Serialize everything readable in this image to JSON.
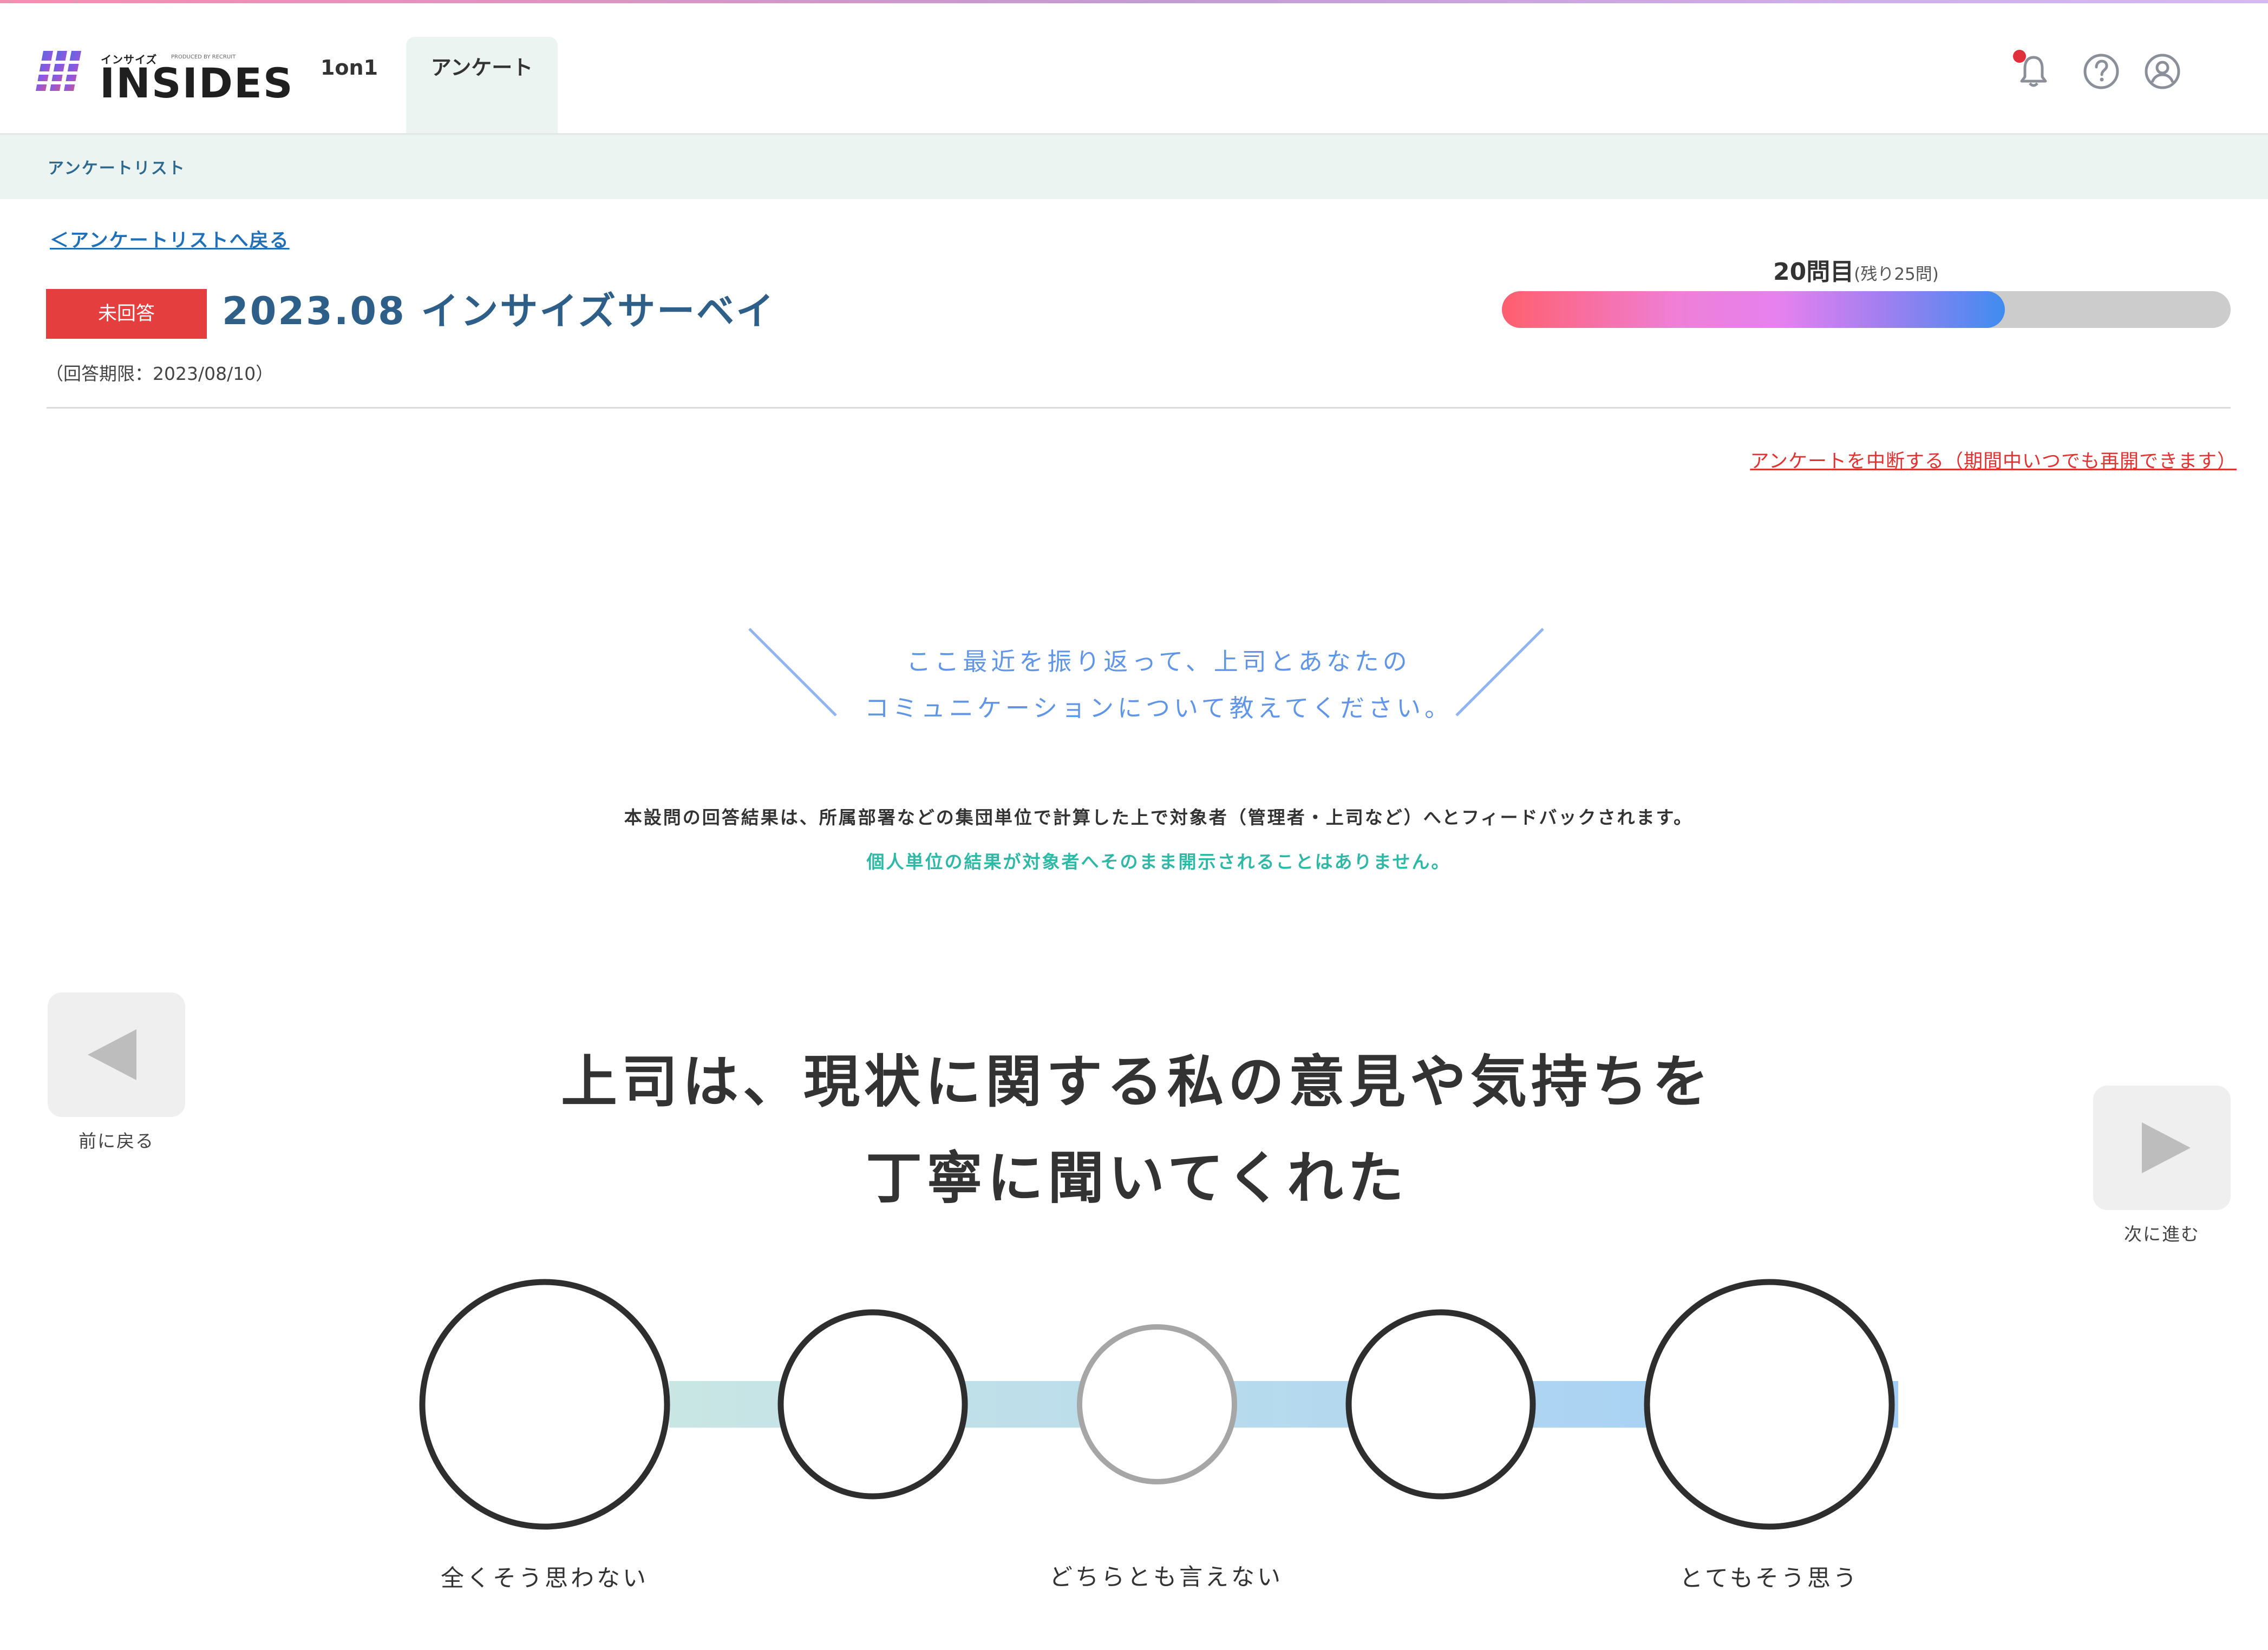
{
  "app": {
    "logo": {
      "small_text": "インサイズ",
      "produced_by": "PRODUCED BY RECRUIT",
      "main_text": "INSIDES"
    },
    "tabs": [
      {
        "label": "1on1"
      },
      {
        "label": "アンケート"
      }
    ],
    "header_icons": [
      "bell-icon",
      "help-icon",
      "account-icon"
    ],
    "colors": {
      "accent_red": "#e53e3e",
      "title_blue": "#2d5f88",
      "prompt_blue": "#6196e6",
      "notice_green": "#2fb8a6",
      "subbar_bg": "#ecf4f1"
    }
  },
  "subnav": {
    "breadcrumb": "アンケートリスト"
  },
  "survey": {
    "back_link": "＜アンケートリストへ戻る",
    "status": "未回答",
    "title": "2023.08 インサイズサーベイ",
    "deadline": "（回答期限：2023/08/10）",
    "progress": {
      "current": "20問目",
      "remaining": "(残り25問)",
      "fraction": 0.69
    },
    "suspend_link": "アンケートを中断する（期間中いつでも再開できます）"
  },
  "section": {
    "prompt_line1": "ここ最近を振り返って、上司とあなたの",
    "prompt_line2": "コミュニケーションについて教えてください。",
    "notice": "本設問の回答結果は、所属部署などの集団単位で計算した上で対象者（管理者・上司など）へとフィードバックされます。",
    "notice_green": "個人単位の結果が対象者へそのまま開示されることはありません。"
  },
  "navigation": {
    "prev_label": "前に戻る",
    "next_label": "次に進む"
  },
  "question": {
    "line1": "上司は、現状に関する私の意見や気持ちを",
    "line2": "丁寧に聞いてくれた",
    "scale_labels": {
      "left": "全くそう思わない",
      "middle": "どちらとも言えない",
      "right": "とてもそう思う"
    },
    "options": 5,
    "selected": null
  }
}
